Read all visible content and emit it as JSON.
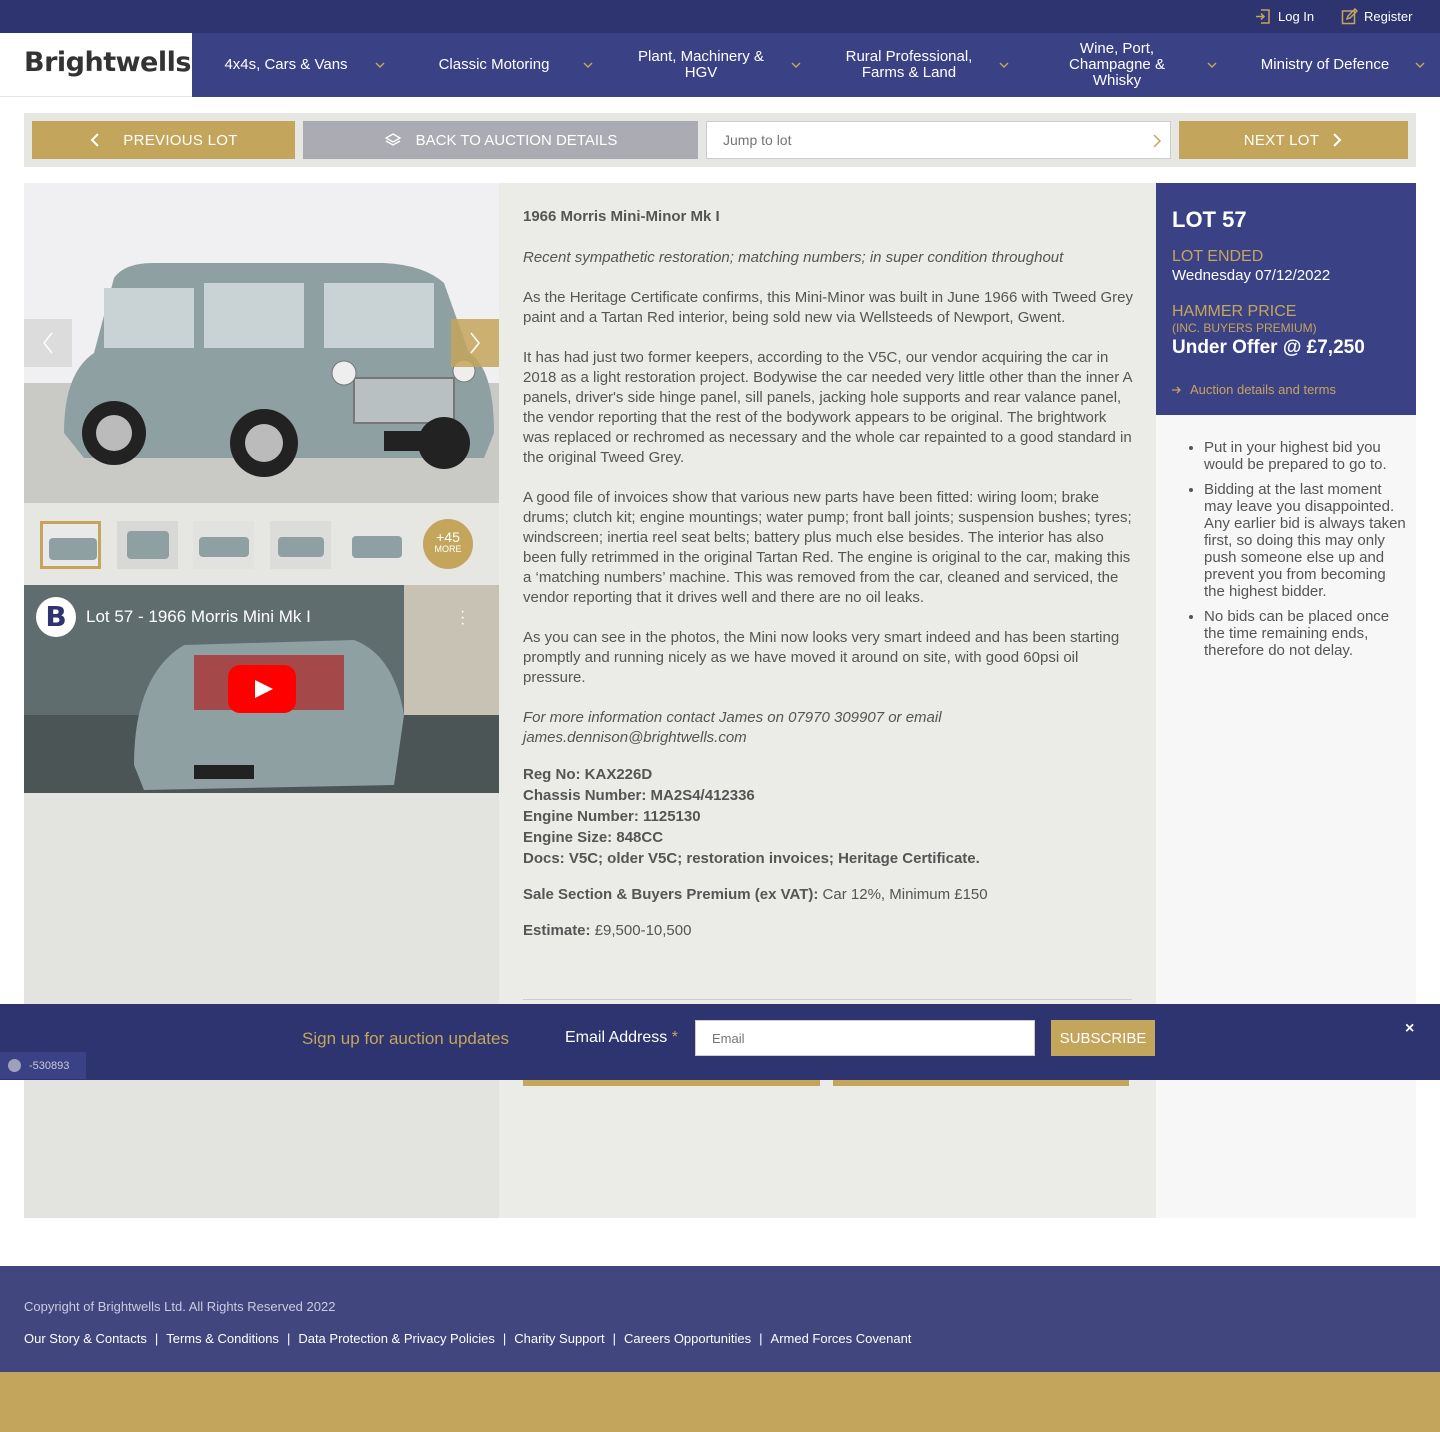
{
  "topbar": {
    "login": "Log In",
    "register": "Register"
  },
  "brand": {
    "logo": "Brightwells"
  },
  "nav": [
    {
      "label": "4x4s, Cars & Vans"
    },
    {
      "label": "Classic Motoring"
    },
    {
      "label": "Plant, Machinery & HGV"
    },
    {
      "label": "Rural Professional, Farms & Land"
    },
    {
      "label": "Wine, Port, Champagne & Whisky"
    },
    {
      "label": "Ministry of Defence"
    }
  ],
  "lot_nav": {
    "previous": "PREVIOUS LOT",
    "back": "BACK TO AUCTION DETAILS",
    "jump_placeholder": "Jump to lot",
    "next": "NEXT LOT"
  },
  "gallery": {
    "more_count": "+45",
    "more_label": "MORE"
  },
  "video": {
    "title": "Lot 57 - 1966 Morris Mini Mk I",
    "channel_letter": "B"
  },
  "description": {
    "title": "1966  Morris Mini-Minor Mk I",
    "subtitle": "Recent sympathetic restoration; matching numbers; in super condition throughout",
    "p1": "As the Heritage Certificate confirms, this Mini-Minor was built in June 1966 with Tweed Grey paint and a Tartan Red interior, being sold new via Wellsteeds of Newport, Gwent.",
    "p2": "It has had just two former keepers, according to the V5C, our vendor acquiring the car in 2018 as a light restoration project. Bodywise the car needed very little other than the inner A panels, driver's side hinge panel, sill panels, jacking hole supports and rear valance panel, the vendor reporting that the rest of the bodywork appears to be original. The brightwork was replaced or rechromed as necessary and the whole car repainted to a good standard in the original Tweed Grey.",
    "p3": "A good file of invoices show that various new parts have been fitted: wiring loom; brake drums; clutch kit; engine mountings; water pump; front ball joints; suspension bushes; tyres; windscreen; inertia reel seat belts; battery plus much else besides. The interior has also been fully retrimmed in the original Tartan Red. The engine is original to the car, making this a ‘matching numbers’ machine. This was removed from the car, cleaned and serviced, the vendor reporting that it drives well and there are no oil leaks.",
    "p4": "As you can see in the photos, the Mini now looks very smart indeed and has been starting promptly and running nicely as we have moved it around on site, with good 60psi oil pressure.",
    "contact": "For more information contact James on 07970 309907 or email james.dennison@brightwells.com",
    "reg": "Reg No: KAX226D",
    "chassis": "Chassis Number: MA2S4/412336",
    "engine_no": "Engine Number: 1125130",
    "engine_size": "Engine Size: 848CC",
    "docs": "Docs: V5C; older V5C; restoration invoices; Heritage Certificate.",
    "premium_label": "Sale Section & Buyers Premium (ex VAT):",
    "premium_value": " Car 12%, Minimum £150",
    "estimate_label": "Estimate:",
    "estimate_value": " £9,500-10,500"
  },
  "lot_box": {
    "lot": "LOT 57",
    "ended_label": "LOT ENDED",
    "ended_date": "Wednesday 07/12/2022",
    "hammer_label": "HAMMER PRICE",
    "hammer_note": "(INC. BUYERS PREMIUM)",
    "price": "Under Offer @ £7,250",
    "terms_link": "Auction details and terms"
  },
  "tips": [
    "Put in your highest bid you would be prepared to go to.",
    "Bidding at the last moment may leave you disappointed. Any earlier bid is always taken first, so doing this may only push someone else up and prevent you from becoming the highest bidder.",
    "No bids can be placed once the time remaining ends, therefore do not delay."
  ],
  "signup": {
    "lead": "Sign up for auction updates",
    "email_label": "Email Address",
    "required": "*",
    "email_placeholder": "Email",
    "subscribe": "SUBSCRIBE",
    "close": "×"
  },
  "badge": {
    "text": "-530893"
  },
  "footer": {
    "copyright": "Copyright of Brightwells Ltd. All Rights Reserved 2022",
    "links": [
      "Our Story & Contacts",
      "Terms & Conditions",
      "Data Protection & Privacy Policies",
      "Charity Support",
      "Careers Opportunities",
      "Armed Forces Covenant"
    ],
    "separator": "|"
  },
  "colors": {
    "navy": "#2d3470",
    "nav": "#3b4185",
    "gold": "#c4a55c"
  },
  "icons": {
    "login": "login-icon",
    "register": "edit-icon",
    "layers": "layers-icon"
  }
}
